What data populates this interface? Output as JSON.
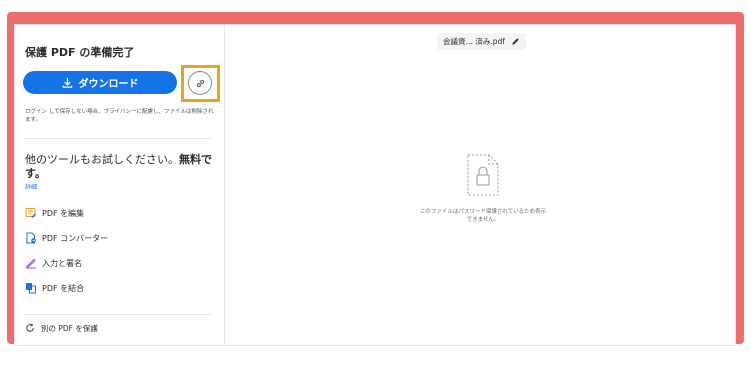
{
  "left_panel": {
    "title": "保護 PDF の準備完了",
    "download_label": "ダウンロード",
    "note": "ログイン して保存しない場合、プライバシーに配慮し、ファイルは削除されます。",
    "promo_text": "他のツールもお試しください。",
    "promo_bold": "無料です。",
    "details_link": "詳細",
    "tools": [
      {
        "label": "PDF を編集",
        "icon": "edit-pdf-icon",
        "color": "#e8a21b"
      },
      {
        "label": "PDF コンバーター",
        "icon": "convert-pdf-icon",
        "color": "#1473e6"
      },
      {
        "label": "入力と署名",
        "icon": "sign-icon",
        "color": "#8b52c9"
      },
      {
        "label": "PDF を結合",
        "icon": "combine-pdf-icon",
        "color": "#1473e6"
      }
    ],
    "protect_another_label": "別の PDF を保護"
  },
  "viewer": {
    "filename": "会議資… 済み.pdf",
    "protected_message": "このファイルはパスワード保護されているため表示できません。"
  },
  "colors": {
    "primary": "#1473e6",
    "highlight": "#e8a21b",
    "frame": "#ee6e6e"
  }
}
